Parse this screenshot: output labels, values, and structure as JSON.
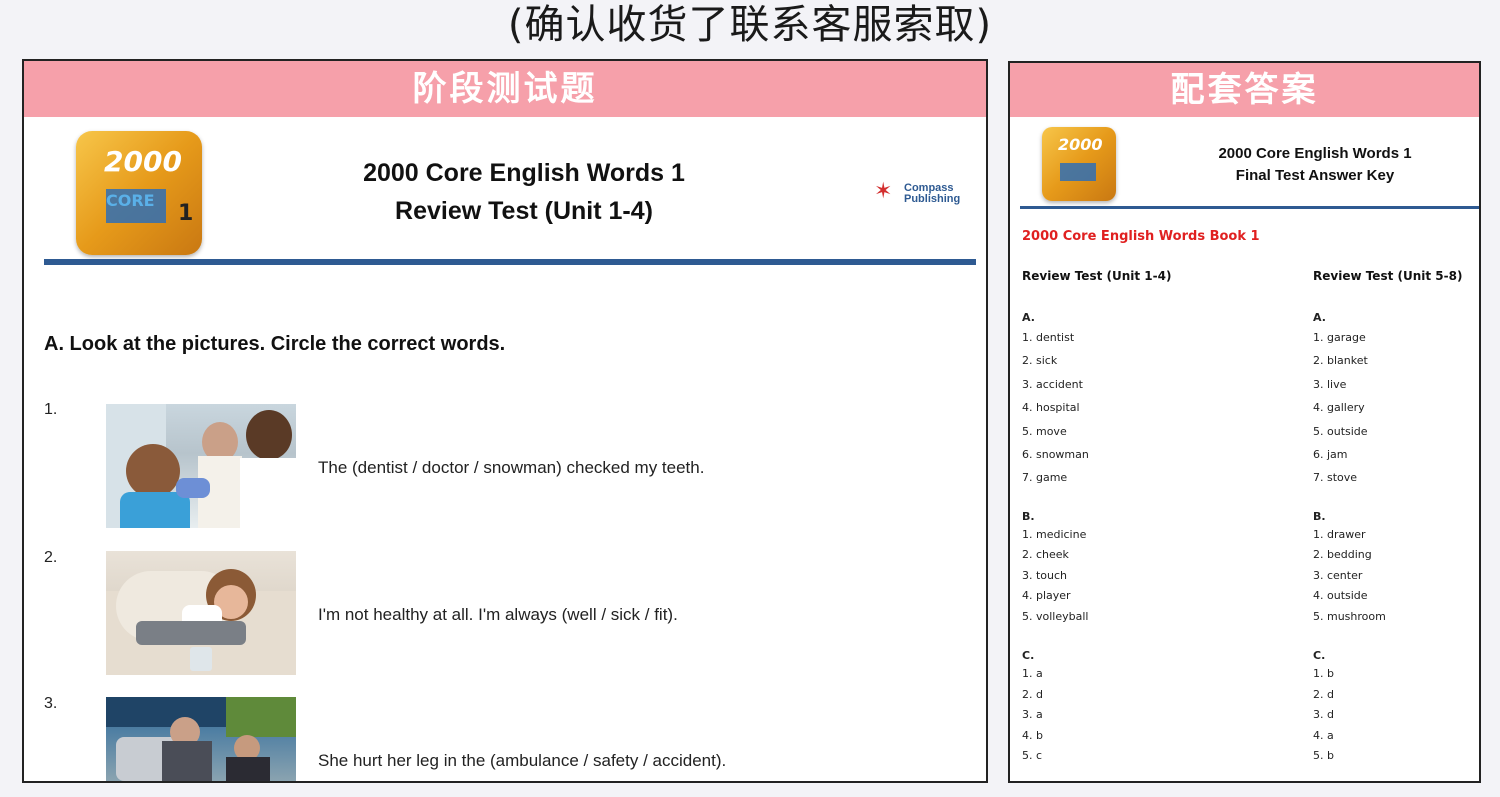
{
  "top_note": "(确认收货了联系客服索取)",
  "left": {
    "header": "阶段测试题",
    "cover": {
      "number": "2000",
      "core": "CORE",
      "volume": "1"
    },
    "title_line1": "2000 Core English Words 1",
    "title_line2": "Review Test (Unit 1-4)",
    "logo_line1": "Compass",
    "logo_line2": "Publishing",
    "section_a": "A. Look at the pictures. Circle the correct words.",
    "questions": [
      {
        "num": "1.",
        "text": "The (dentist / doctor / snowman) checked my teeth."
      },
      {
        "num": "2.",
        "text": "I'm not healthy at all. I'm always (well / sick / fit)."
      },
      {
        "num": "3.",
        "text": "She hurt her leg in the (ambulance / safety / accident)."
      }
    ]
  },
  "right": {
    "header": "配套答案",
    "cover": {
      "number": "2000"
    },
    "title_line1": "2000 Core English Words 1",
    "title_line2": "Final Test Answer Key",
    "book_label": "2000 Core English Words Book 1",
    "col1_head": "Review Test (Unit 1-4)",
    "col2_head": "Review Test (Unit 5-8)",
    "col1": {
      "A_label": "A.",
      "A": [
        "1. dentist",
        "2. sick",
        "3. accident",
        "4. hospital",
        "5. move",
        "6. snowman",
        "7. game"
      ],
      "B_label": "B.",
      "B": [
        "1. medicine",
        "2. cheek",
        "3. touch",
        "4. player",
        "5. volleyball"
      ],
      "C_label": "C.",
      "C": [
        "1. a",
        "2. d",
        "3. a",
        "4. b",
        "5. c"
      ]
    },
    "col2": {
      "A_label": "A.",
      "A": [
        "1. garage",
        "2. blanket",
        "3. live",
        "4. gallery",
        "5. outside",
        "6. jam",
        "7. stove"
      ],
      "B_label": "B.",
      "B": [
        "1. drawer",
        "2. bedding",
        "3. center",
        "4. outside",
        "5. mushroom"
      ],
      "C_label": "C.",
      "C": [
        "1. b",
        "2. d",
        "3. d",
        "4. a",
        "5. b"
      ]
    }
  }
}
